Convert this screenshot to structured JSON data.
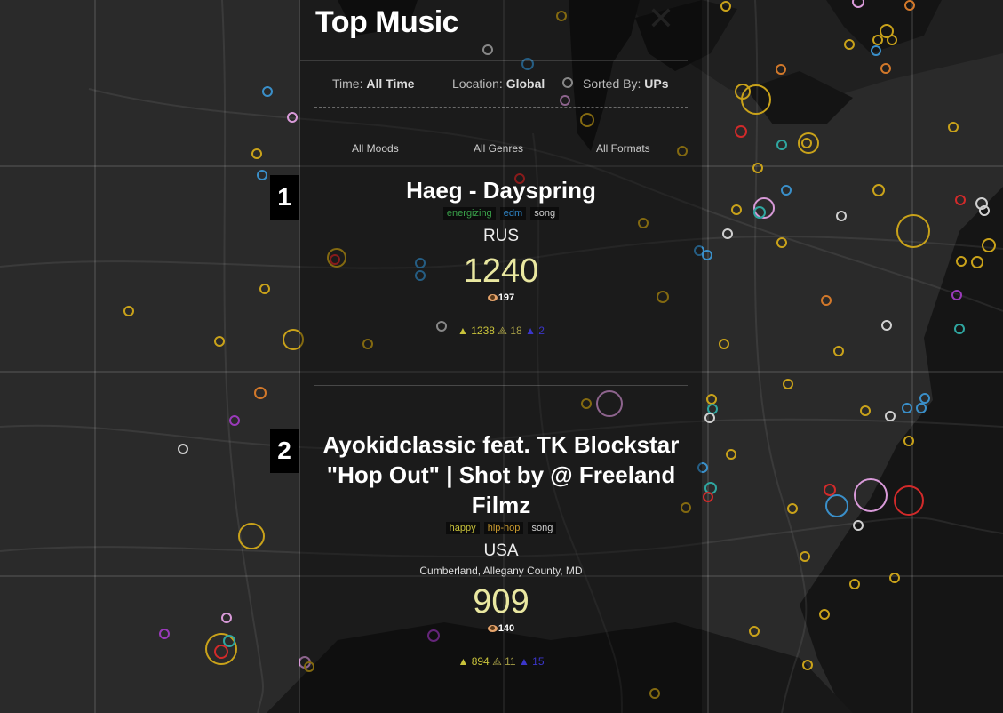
{
  "header": {
    "title": "Top Music",
    "close_glyph": "✕"
  },
  "filters": {
    "time_label": "Time:",
    "time_value": "All Time",
    "location_label": "Location:",
    "location_value": "Global",
    "sort_label": "Sorted By:",
    "sort_value": "UPs"
  },
  "sub_filters": {
    "moods": "All Moods",
    "genres": "All Genres",
    "formats": "All Formats"
  },
  "entries": [
    {
      "rank": "1",
      "title": "Haeg - Dayspring",
      "tags": [
        {
          "label": "energizing",
          "color": "#3aa14a"
        },
        {
          "label": "edm",
          "color": "#2f86c9"
        },
        {
          "label": "song",
          "color": "#cfcfcf"
        }
      ],
      "country": "RUS",
      "location": "",
      "score": "1240",
      "views": "197",
      "ups": "1238",
      "mids": "18",
      "downs": "2"
    },
    {
      "rank": "2",
      "title": "Ayokidclassic feat. TK Blockstar \"Hop Out\" | Shot by @ Freeland Filmz",
      "tags": [
        {
          "label": "happy",
          "color": "#c8c23a"
        },
        {
          "label": "hip-hop",
          "color": "#c99a2f"
        },
        {
          "label": "song",
          "color": "#cfcfcf"
        }
      ],
      "country": "USA",
      "location": "Cumberland, Allegany County, MD",
      "score": "909",
      "views": "140",
      "ups": "894",
      "mids": "11",
      "downs": "15"
    }
  ],
  "colors": {
    "gold": "#c9a21a",
    "teal": "#2fa6a0",
    "blue": "#3a8fc9",
    "red": "#d22a2a",
    "pink": "#d99ad9",
    "purple": "#9a3aba",
    "white": "#cfcfcf",
    "orange": "#d2782a"
  }
}
